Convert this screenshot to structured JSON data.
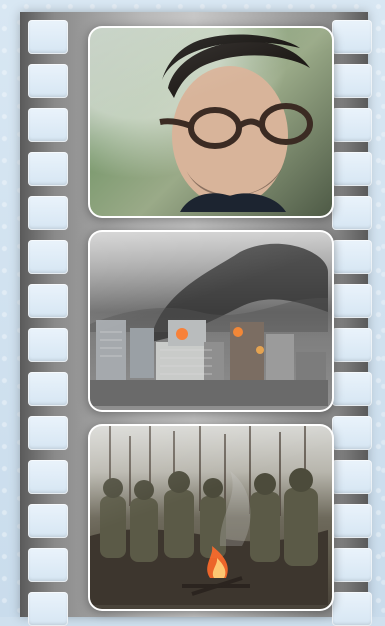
{
  "film_strip": {
    "frames": [
      {
        "subject": "portrait"
      },
      {
        "subject": "burning-city"
      },
      {
        "subject": "soldiers-campfire"
      }
    ]
  }
}
